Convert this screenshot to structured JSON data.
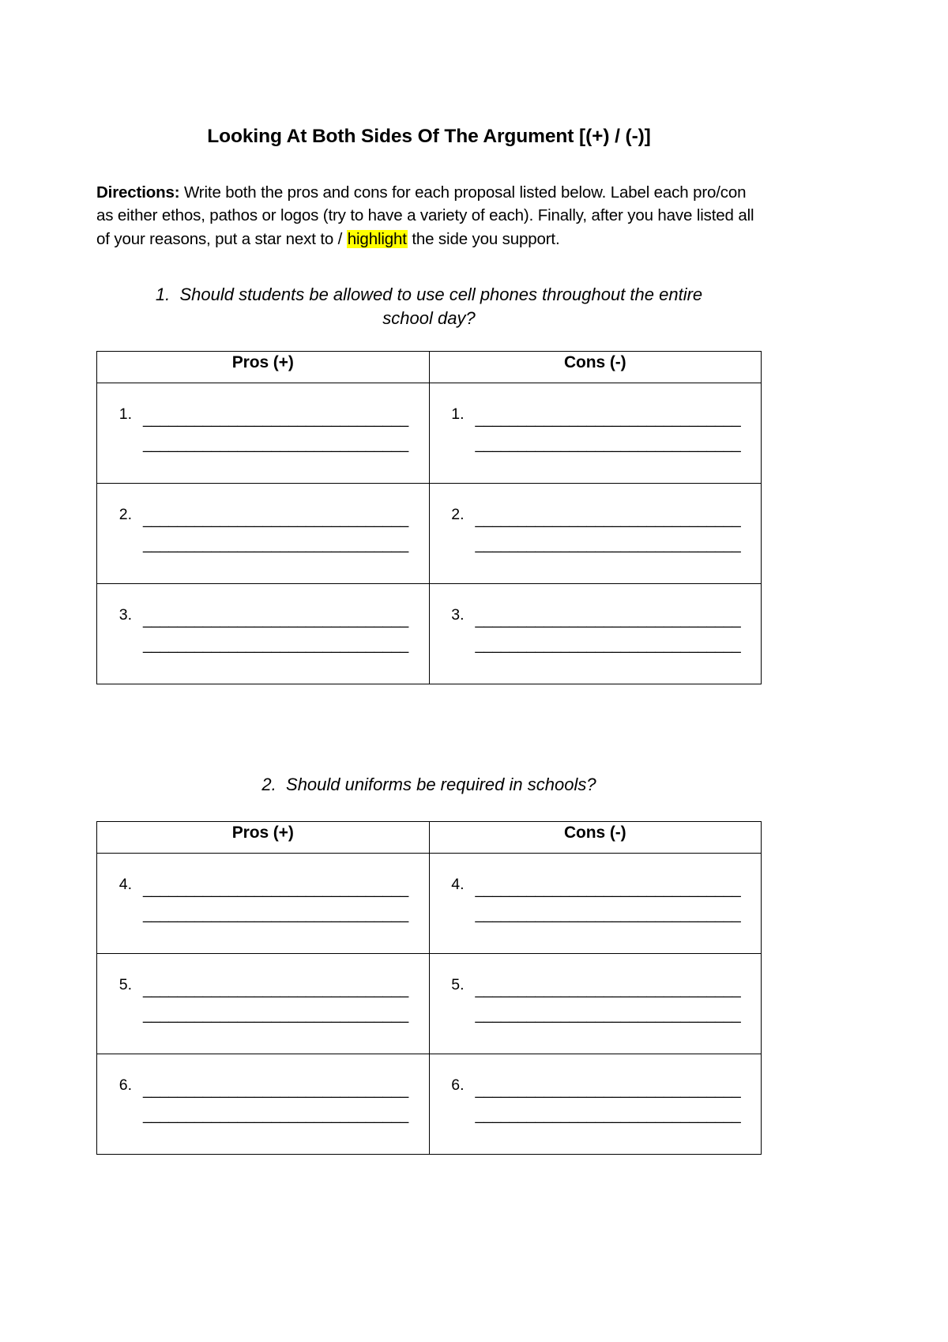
{
  "document": {
    "title": "Looking At Both Sides Of The Argument [(+) / (-)]",
    "directions": {
      "lead": "Directions:",
      "text_part1": " Write both the pros and cons for each proposal listed below. Label each pro/con as either ethos, pathos or logos (try to have a variety of each). Finally, after you have listed all of your reasons, put a star next to / ",
      "highlighted": "highlight",
      "text_part2": " the side you support."
    },
    "questions": [
      {
        "number": "1.",
        "line1": "Should students be allowed to use cell phones throughout the entire",
        "line2": "school day?"
      },
      {
        "number": "2.",
        "line1": "Should uniforms be required in schools?",
        "line2": ""
      }
    ],
    "table_headers": {
      "pros": "Pros (+)",
      "cons": "Cons (-)"
    },
    "tables": [
      {
        "rows": [
          {
            "pro_number": "1.",
            "pro_line1": "_______________________________",
            "pro_line2": "_______________________________",
            "con_number": "1.",
            "con_line1": "_______________________________",
            "con_line2": "_______________________________"
          },
          {
            "pro_number": "2.",
            "pro_line1": "_______________________________",
            "pro_line2": "_______________________________",
            "con_number": "2.",
            "con_line1": "_______________________________",
            "con_line2": "_______________________________"
          },
          {
            "pro_number": "3.",
            "pro_line1": "_______________________________",
            "pro_line2": "_______________________________",
            "con_number": "3.",
            "con_line1": "_______________________________",
            "con_line2": "_______________________________"
          }
        ]
      },
      {
        "rows": [
          {
            "pro_number": "4.",
            "pro_line1": "_______________________________",
            "pro_line2": "_______________________________",
            "con_number": "4.",
            "con_line1": "_______________________________",
            "con_line2": "_______________________________"
          },
          {
            "pro_number": "5.",
            "pro_line1": "_______________________________",
            "pro_line2": "_______________________________",
            "con_number": "5.",
            "con_line1": "_______________________________",
            "con_line2": "_______________________________"
          },
          {
            "pro_number": "6.",
            "pro_line1": "_______________________________",
            "pro_line2": "_______________________________",
            "con_number": "6.",
            "con_line1": "_______________________________",
            "con_line2": "_______________________________"
          }
        ]
      }
    ],
    "colors": {
      "highlight": "#ffff00",
      "text": "#000000",
      "page_background": "#ffffff",
      "table_border": "#000000"
    }
  }
}
